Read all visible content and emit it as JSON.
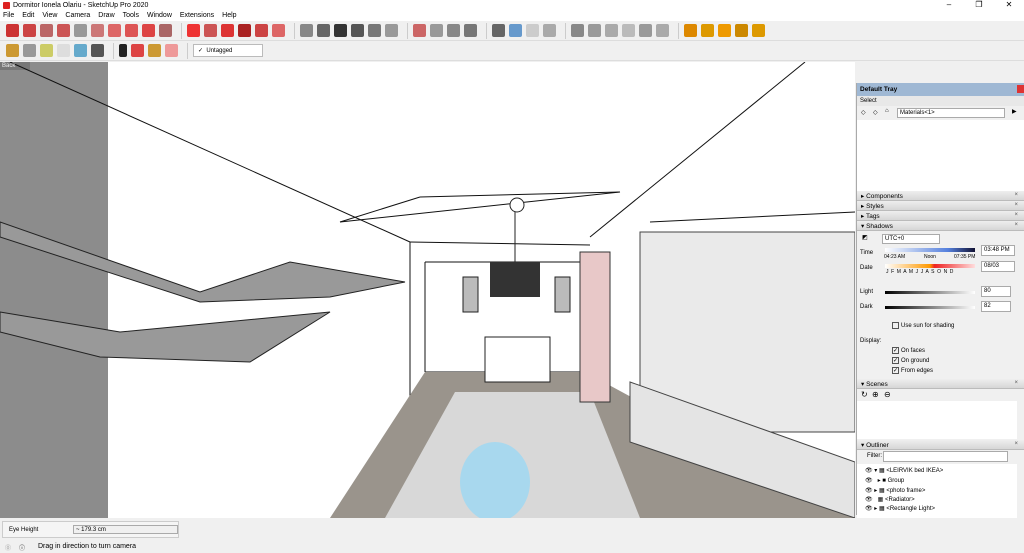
{
  "window": {
    "title": "Dormitor Ionela Olariu - SketchUp Pro 2020",
    "controls": [
      "–",
      "❐",
      "✕"
    ]
  },
  "menu": [
    "File",
    "Edit",
    "View",
    "Camera",
    "Draw",
    "Tools",
    "Window",
    "Extensions",
    "Help"
  ],
  "toolbar": {
    "tag_select": "Untagged",
    "tag_check": "✓"
  },
  "viewport": {
    "scene_tab": "Back"
  },
  "tray": {
    "title": "Default Tray",
    "select_label": "Select",
    "materials_value": "Materials<1>",
    "sections": {
      "components": "Components",
      "styles": "Styles",
      "tags": "Tags",
      "shadows": "Shadows",
      "scenes": "Scenes",
      "outliner": "Outliner"
    },
    "shadows": {
      "timezone": "UTC+0",
      "time_label": "Time",
      "time_start": "04:23 AM",
      "time_mid": "Noon",
      "time_end": "07:35 PM",
      "time_value": "03:48 PM",
      "date_label": "Date",
      "months": "J F M A M J J A S O N D",
      "date_value": "08/03",
      "light_label": "Light",
      "light_value": "80",
      "dark_label": "Dark",
      "dark_value": "82",
      "light_level": 0.8,
      "dark_level": 0.82,
      "use_sun": "Use sun for shading",
      "display_label": "Display:",
      "on_faces": "On faces",
      "on_ground": "On ground",
      "from_edges": "From edges"
    },
    "outliner": {
      "filter_label": "Filter:",
      "filter_value": "",
      "items": [
        "<LEIRVIK bed IKEA>",
        "Group",
        "<photo frame>",
        "<Radiator>",
        "<Rectangle Light>"
      ]
    }
  },
  "status": {
    "measure_label": "Eye Height",
    "measure_value": "~ 179.3 cm",
    "hint": "Drag in direction to turn camera"
  }
}
